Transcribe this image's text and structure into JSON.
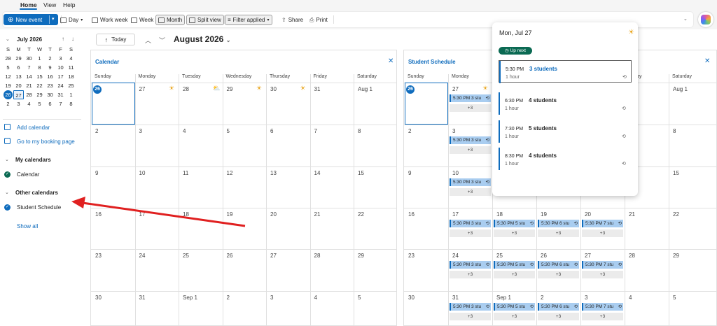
{
  "menu": {
    "tabs": [
      "Home",
      "View",
      "Help"
    ]
  },
  "toolbar": {
    "new_event": "New event",
    "day": "Day",
    "work_week": "Work week",
    "week": "Week",
    "month": "Month",
    "split_view": "Split view",
    "filter": "Filter applied",
    "share": "Share",
    "print": "Print"
  },
  "mini_calendar": {
    "title": "July 2026",
    "weekdays": [
      "S",
      "M",
      "T",
      "W",
      "T",
      "F",
      "S"
    ],
    "weeks": [
      [
        "28",
        "29",
        "30",
        "1",
        "2",
        "3",
        "4"
      ],
      [
        "5",
        "6",
        "7",
        "8",
        "9",
        "10",
        "11"
      ],
      [
        "12",
        "13",
        "14",
        "15",
        "16",
        "17",
        "18"
      ],
      [
        "19",
        "20",
        "21",
        "22",
        "23",
        "24",
        "25"
      ],
      [
        "26",
        "27",
        "28",
        "29",
        "30",
        "31",
        "1"
      ],
      [
        "2",
        "3",
        "4",
        "5",
        "6",
        "7",
        "8"
      ]
    ]
  },
  "sidebar": {
    "add_calendar": "Add calendar",
    "booking_page": "Go to my booking page",
    "my_calendars": "My calendars",
    "calendar": "Calendar",
    "other_calendars": "Other calendars",
    "student_schedule": "Student Schedule",
    "show_all": "Show all"
  },
  "nav": {
    "today": "Today",
    "title": "August 2026"
  },
  "days": [
    "Sunday",
    "Monday",
    "Tuesday",
    "Wednesday",
    "Thursday",
    "Friday",
    "Saturday"
  ],
  "weeks": [
    [
      "26",
      "27",
      "28",
      "29",
      "30",
      "31",
      "Aug 1"
    ],
    [
      "2",
      "3",
      "4",
      "5",
      "6",
      "7",
      "8"
    ],
    [
      "9",
      "10",
      "11",
      "12",
      "13",
      "14",
      "15"
    ],
    [
      "16",
      "17",
      "18",
      "19",
      "20",
      "21",
      "22"
    ],
    [
      "23",
      "24",
      "25",
      "26",
      "27",
      "28",
      "29"
    ],
    [
      "30",
      "31",
      "Sep 1",
      "2",
      "3",
      "4",
      "5"
    ]
  ],
  "panes": {
    "left": {
      "title": "Calendar"
    },
    "right": {
      "title": "Student Schedule"
    }
  },
  "events": {
    "e3": "5:30 PM 3 stu",
    "e5": "5:30 PM 5 stu",
    "e6": "5:30 PM 6 stu",
    "e7": "5:30 PM 7 stu",
    "more": "+3"
  },
  "popup": {
    "title": "Mon, Jul 27",
    "upnext": "Up next",
    "items": [
      {
        "time": "5:30 PM",
        "dur": "1 hour",
        "title": "3 students"
      },
      {
        "time": "6:30 PM",
        "dur": "1 hour",
        "title": "4 students"
      },
      {
        "time": "7:30 PM",
        "dur": "1 hour",
        "title": "5 students"
      },
      {
        "time": "8:30 PM",
        "dur": "1 hour",
        "title": "4 students"
      }
    ]
  },
  "colors": {
    "accent": "#0f6cbd",
    "event_fill": "#a9cdf0",
    "upnext": "#0b6a53",
    "arrow": "#e02020"
  }
}
